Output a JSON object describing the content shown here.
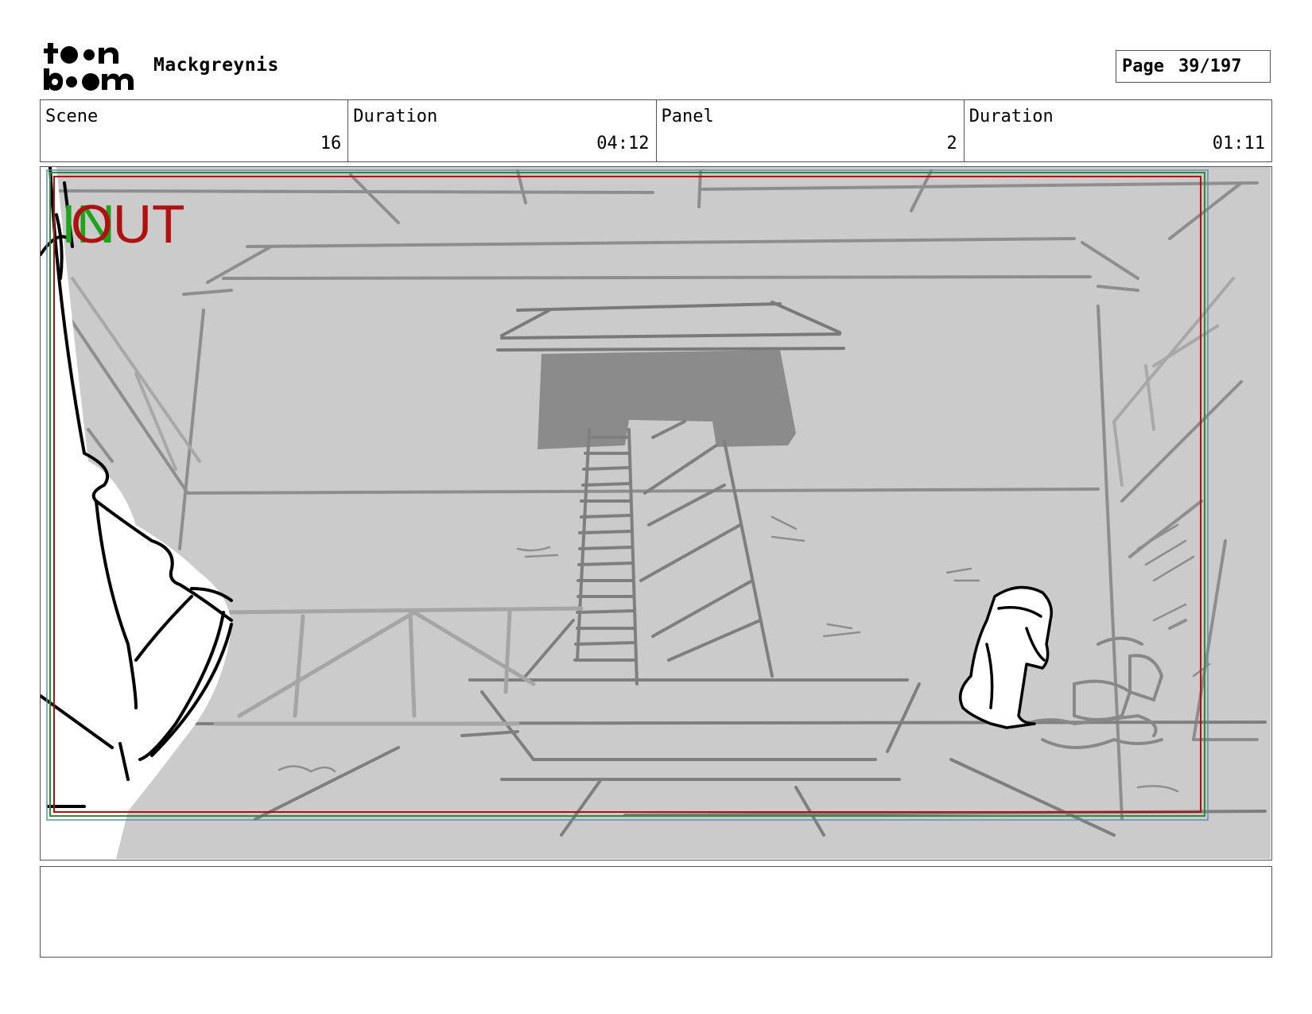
{
  "header": {
    "logo_text": "toon boom",
    "project_title": "Mackgreynis",
    "page_label": "Page",
    "page_number": "39/197"
  },
  "info": {
    "scene_label": "Scene",
    "scene_value": "16",
    "scene_duration_label": "Duration",
    "scene_duration_value": "04:12",
    "panel_label": "Panel",
    "panel_value": "2",
    "panel_duration_label": "Duration",
    "panel_duration_value": "01:11"
  },
  "panel": {
    "in_marker": "IN",
    "out_marker": "OUT",
    "in_color": "#1aa51a",
    "out_color": "#b01010",
    "background_color": "#cbcbcb"
  },
  "notes": {
    "text": ""
  }
}
